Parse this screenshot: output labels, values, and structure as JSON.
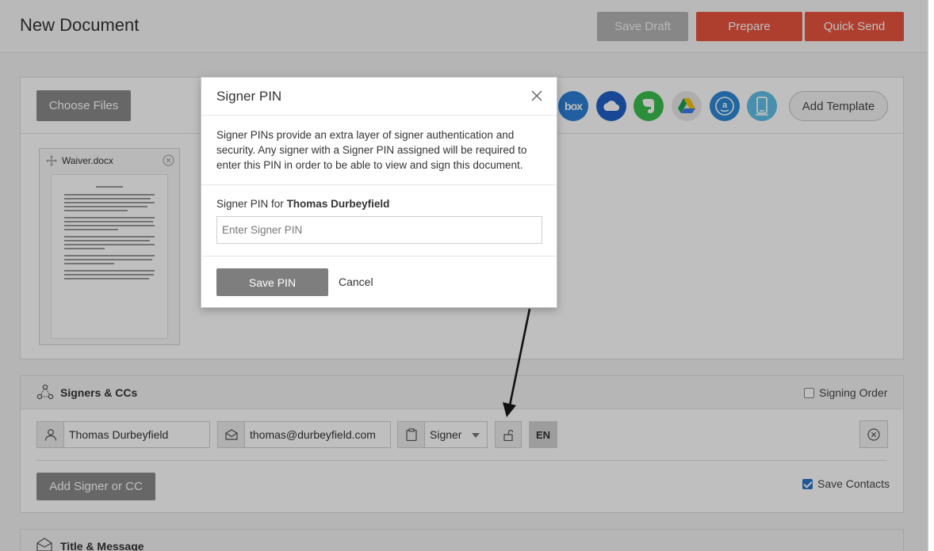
{
  "header": {
    "title": "New Document",
    "save_draft": "Save Draft",
    "prepare": "Prepare",
    "quick_send": "Quick Send"
  },
  "files": {
    "choose_files": "Choose Files",
    "cloud_services": [
      "box-icon",
      "onedrive-icon",
      "evernote-icon",
      "google-drive-icon",
      "amazon-icon",
      "device-icon"
    ],
    "box_label": "box",
    "add_template": "Add Template",
    "document": {
      "name": "Waiver.docx"
    }
  },
  "signers": {
    "title": "Signers & CCs",
    "signing_order_label": "Signing Order",
    "signing_order_checked": false,
    "signer": {
      "name": "Thomas Durbeyfield",
      "email": "thomas@durbeyfield.com",
      "role": "Signer",
      "language": "EN"
    },
    "add_signer": "Add Signer or CC",
    "save_contacts_label": "Save Contacts",
    "save_contacts_checked": true
  },
  "title_message": {
    "title": "Title & Message"
  },
  "modal": {
    "title": "Signer PIN",
    "description": "Signer PINs provide an extra layer of signer authentication and security. Any signer with a Signer PIN assigned will be required to enter this PIN in order to be able to view and sign this document.",
    "pin_label_prefix": "Signer PIN for",
    "pin_label_name": "Thomas Durbeyfield",
    "pin_placeholder": "Enter Signer PIN",
    "pin_value": "",
    "save_pin": "Save PIN",
    "cancel": "Cancel"
  },
  "colors": {
    "accent": "#e8553f",
    "primary_grey": "#8a8a8a",
    "checkbox_blue": "#2a74c9"
  }
}
